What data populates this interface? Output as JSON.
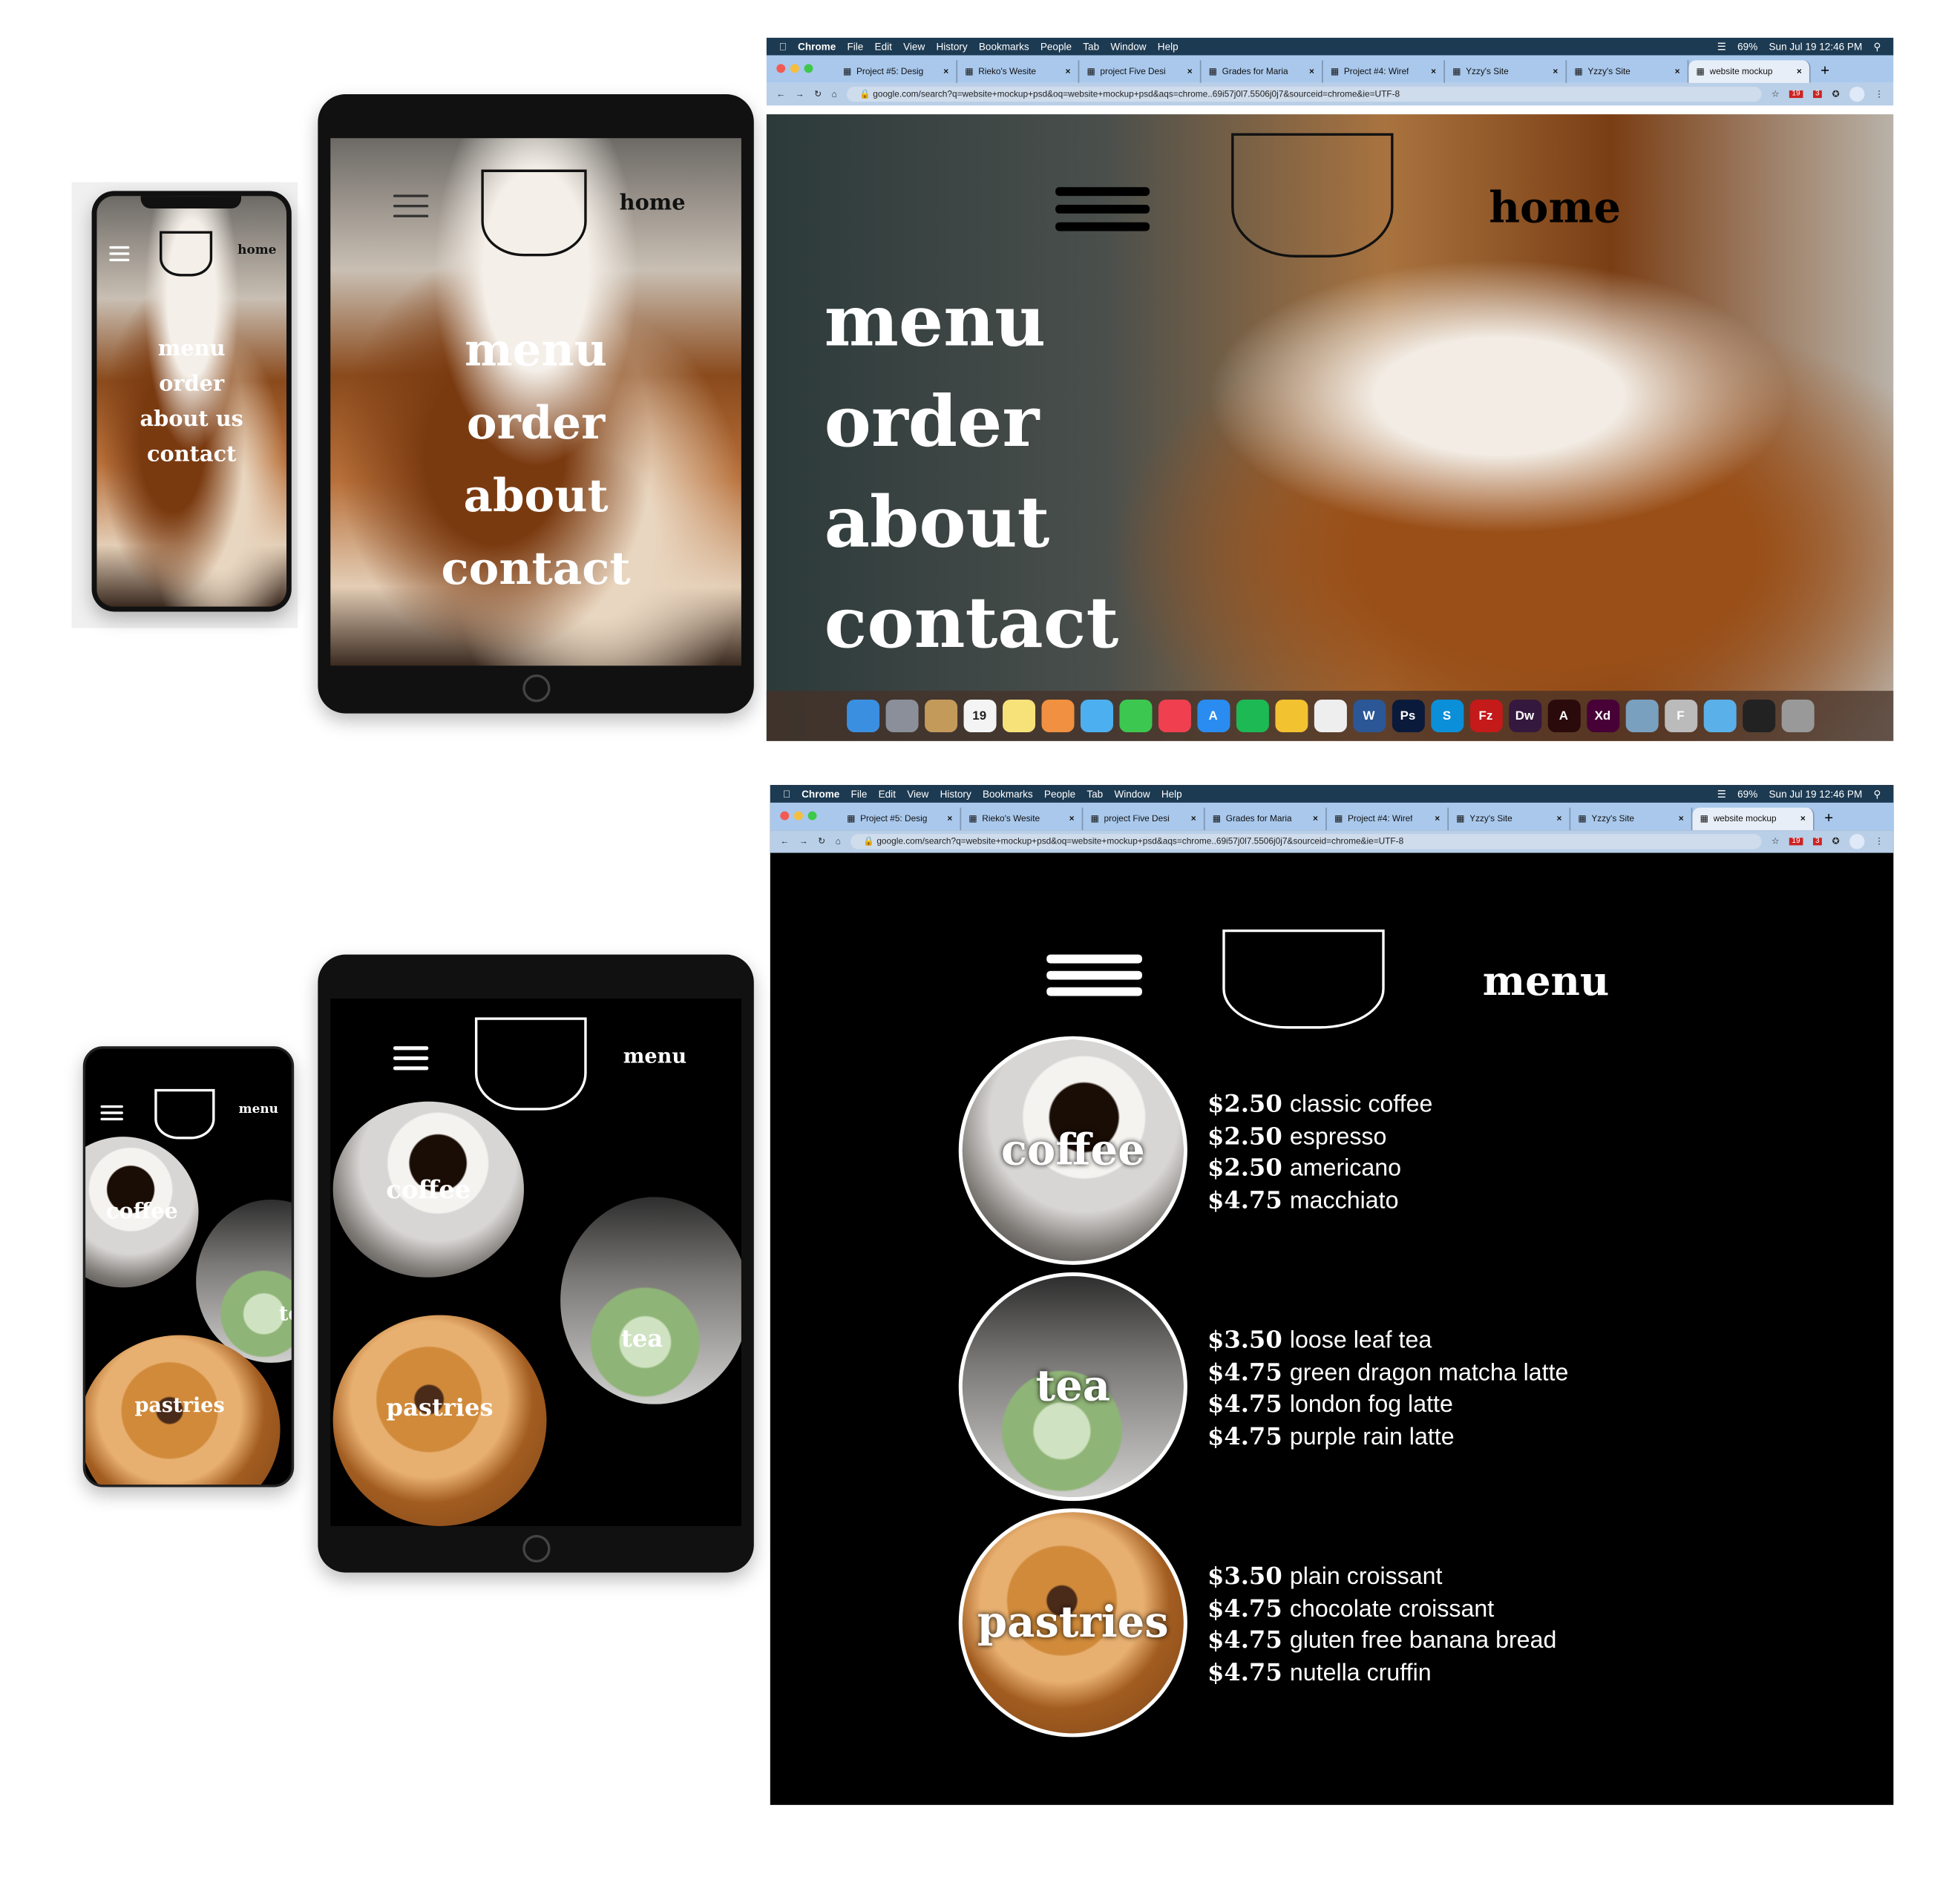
{
  "colors": {
    "menubar": "#1c3a52",
    "tabbar": "#a9c8ec",
    "page_bg": "#000000",
    "text": "#ffffff"
  },
  "mac_menubar": {
    "app": "Chrome",
    "items": [
      "File",
      "Edit",
      "View",
      "History",
      "Bookmarks",
      "People",
      "Tab",
      "Window",
      "Help"
    ],
    "battery": "69%",
    "datetime": "Sun Jul 19  12:46 PM"
  },
  "browser": {
    "tabs": [
      {
        "label": "Project #5: Desig",
        "icon": "doc-icon"
      },
      {
        "label": "Rieko's Wesite",
        "icon": "page-icon"
      },
      {
        "label": "project Five Desi",
        "icon": "page-icon"
      },
      {
        "label": "Grades for Maria",
        "icon": "doc-icon"
      },
      {
        "label": "Project #4: Wiref",
        "icon": "doc-icon"
      },
      {
        "label": "Yzzy's Site",
        "icon": "globe-icon"
      },
      {
        "label": "Yzzy's Site",
        "icon": "globe-icon"
      },
      {
        "label": "website mockup",
        "icon": "google-icon",
        "active": true
      }
    ],
    "url": "google.com/search?q=website+mockup+psd&oq=website+mockup+psd&aqs=chrome..69i57j0l7.5506j0j7&sourceid=chrome&ie=UTF-8",
    "extension_badges": [
      "19",
      "3"
    ]
  },
  "dock": {
    "apps": [
      {
        "name": "finder",
        "label": "",
        "color": "#3b8fe0"
      },
      {
        "name": "launchpad",
        "label": "",
        "color": "#8a8f99"
      },
      {
        "name": "contacts",
        "label": "",
        "color": "#c49a5a"
      },
      {
        "name": "calendar",
        "label": "19",
        "color": "#f4f4f4"
      },
      {
        "name": "notes",
        "label": "",
        "color": "#f7e27a"
      },
      {
        "name": "photos",
        "label": "",
        "color": "#f09040"
      },
      {
        "name": "messages",
        "label": "",
        "color": "#4cb0f0"
      },
      {
        "name": "facetime",
        "label": "",
        "color": "#3cc850"
      },
      {
        "name": "news",
        "label": "",
        "color": "#f04050"
      },
      {
        "name": "app-store",
        "label": "A",
        "color": "#2a8cf0"
      },
      {
        "name": "spotify",
        "label": "",
        "color": "#1db954"
      },
      {
        "name": "chrome",
        "label": "",
        "color": "#f2c230"
      },
      {
        "name": "textedit",
        "label": "",
        "color": "#eeeeee"
      },
      {
        "name": "word",
        "label": "W",
        "color": "#2b5797"
      },
      {
        "name": "photoshop",
        "label": "Ps",
        "color": "#0a1a3a"
      },
      {
        "name": "skype",
        "label": "S",
        "color": "#0b8fd8"
      },
      {
        "name": "filezilla",
        "label": "Fz",
        "color": "#c41a1a"
      },
      {
        "name": "dreamweaver",
        "label": "Dw",
        "color": "#35183d"
      },
      {
        "name": "acrobat",
        "label": "A",
        "color": "#2a0a0a"
      },
      {
        "name": "xd",
        "label": "Xd",
        "color": "#470137"
      },
      {
        "name": "preview",
        "label": "",
        "color": "#7aa0c0"
      },
      {
        "name": "font-book",
        "label": "F",
        "color": "#bbbbbb"
      },
      {
        "name": "downloads",
        "label": "",
        "color": "#5ab0e8"
      },
      {
        "name": "terminal",
        "label": "",
        "color": "#222222"
      },
      {
        "name": "trash",
        "label": "",
        "color": "#999999"
      }
    ]
  },
  "home_page": {
    "header_label": "home",
    "nav_desktop": [
      "menu",
      "order",
      "about",
      "contact"
    ],
    "nav_phone": [
      "menu",
      "order",
      "about us",
      "contact"
    ]
  },
  "menu_page": {
    "header_label": "menu",
    "sections": [
      {
        "category": "coffee",
        "items": [
          {
            "price": "$2.50",
            "name": "classic coffee"
          },
          {
            "price": "$2.50",
            "name": "espresso"
          },
          {
            "price": "$2.50",
            "name": "americano"
          },
          {
            "price": "$4.75",
            "name": "macchiato"
          }
        ]
      },
      {
        "category": "tea",
        "items": [
          {
            "price": "$3.50",
            "name": "loose leaf tea"
          },
          {
            "price": "$4.75",
            "name": "green dragon matcha latte"
          },
          {
            "price": "$4.75",
            "name": "london fog latte"
          },
          {
            "price": "$4.75",
            "name": "purple rain latte"
          }
        ]
      },
      {
        "category": "pastries",
        "items": [
          {
            "price": "$3.50",
            "name": "plain croissant"
          },
          {
            "price": "$4.75",
            "name": "chocolate croissant"
          },
          {
            "price": "$4.75",
            "name": "gluten free banana bread"
          },
          {
            "price": "$4.75",
            "name": "nutella cruffin"
          }
        ]
      }
    ]
  }
}
